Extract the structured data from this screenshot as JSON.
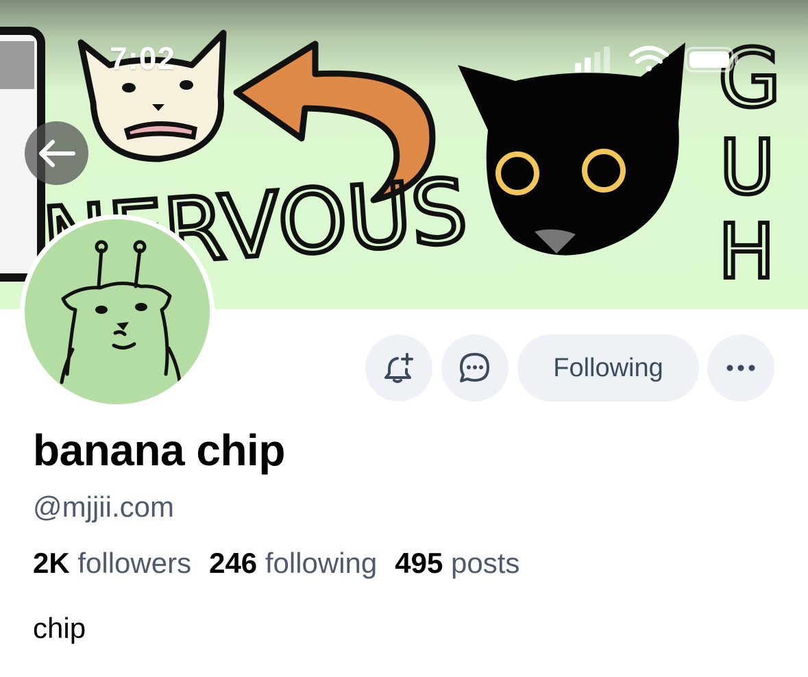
{
  "status_bar": {
    "time": "7:02"
  },
  "banner": {
    "drawn_text": "NERVOUS",
    "side_text": [
      "G",
      "U",
      "H"
    ],
    "background_color": "#dcf9d0"
  },
  "header": {
    "back_icon": "arrow-left-icon"
  },
  "actions": {
    "notify_icon": "bell-plus-icon",
    "message_icon": "chat-bubble-icon",
    "follow_label": "Following",
    "more_icon": "ellipsis-icon"
  },
  "profile": {
    "display_name": "banana chip",
    "handle": "@mjjii.com",
    "stats": [
      {
        "value": "2K",
        "label": "followers"
      },
      {
        "value": "246",
        "label": "following"
      },
      {
        "value": "495",
        "label": "posts"
      }
    ],
    "bio": "chip"
  },
  "colors": {
    "accent_muted": "#4e5b6e",
    "button_bg": "#eef2f7",
    "avatar_bg": "#b3dda3"
  }
}
